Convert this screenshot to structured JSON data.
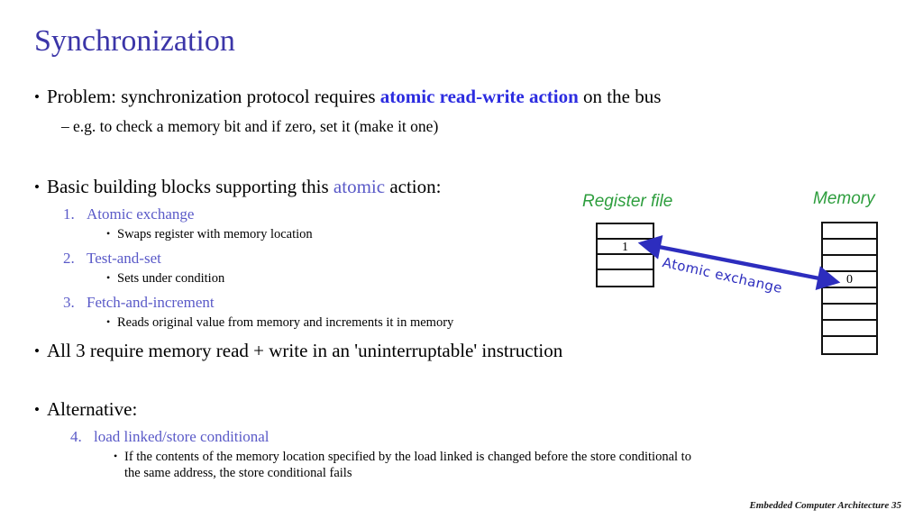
{
  "slide": {
    "title": "Synchronization",
    "footer": "Embedded Computer Architecture  35"
  },
  "colors": {
    "title_blue": "#3b35a8",
    "emphasis_blue": "#2c2ce0",
    "list_blue": "#5a5ac8",
    "diagram_green": "#2e9e3e",
    "arrow_blue": "#2d2dbe",
    "text_black": "#000000",
    "background": "#ffffff"
  },
  "content": {
    "problem": {
      "bullet_glyph": "•",
      "text_before": "Problem: synchronization protocol requires ",
      "emphasis": "atomic read-write action",
      "text_after": " on the bus",
      "sub": {
        "dash_glyph": "–",
        "text": "e.g. to check a memory bit and if zero, set it (make it one)"
      }
    },
    "basic_blocks": {
      "bullet_glyph": "•",
      "text_before": "Basic building blocks supporting this ",
      "emphasis": "atomic",
      "text_after": " action:",
      "items": [
        {
          "number": "1.",
          "label": "Atomic exchange",
          "sub_bullet_glyph": "•",
          "sub_text": "Swaps register with memory location"
        },
        {
          "number": "2.",
          "label": "Test-and-set",
          "sub_bullet_glyph": "•",
          "sub_text": "Sets under condition"
        },
        {
          "number": "3.",
          "label": "Fetch-and-increment",
          "sub_bullet_glyph": "•",
          "sub_text": "Reads original value from memory and increments it in memory"
        }
      ]
    },
    "all_three": {
      "bullet_glyph": "•",
      "text": "All 3 require memory read + write in an 'uninterruptable' instruction"
    },
    "alternative": {
      "bullet_glyph": "•",
      "text": "Alternative:",
      "items": [
        {
          "number": "4.",
          "label": "load linked/store conditional",
          "sub_bullet_glyph": "•",
          "sub_text_line1": "If the contents of the memory location specified by the load linked is changed before the store conditional to",
          "sub_text_line2": "the same address, the store conditional fails"
        }
      ]
    }
  },
  "diagram": {
    "register_file": {
      "label": "Register file",
      "cells": [
        "",
        "1",
        "",
        ""
      ]
    },
    "memory": {
      "label": "Memory",
      "cells": [
        "",
        "",
        "",
        "0",
        "",
        "",
        "",
        ""
      ]
    },
    "arrow": {
      "label": "Atomic exchange",
      "direction": "double-headed"
    }
  }
}
